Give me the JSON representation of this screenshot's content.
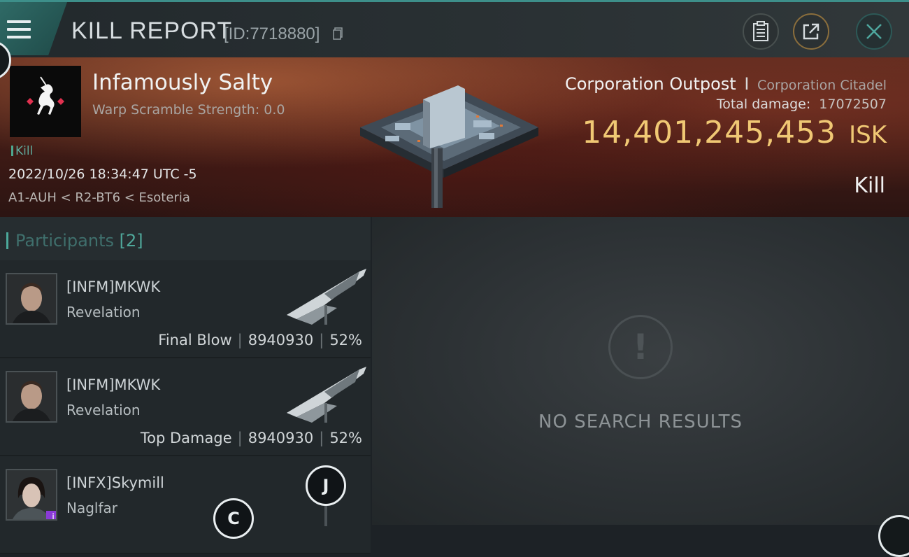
{
  "header": {
    "title": "KILL REPORT",
    "report_id": "[ID:7718880]"
  },
  "victim": {
    "name": "Infamously Salty",
    "warp_scramble": "Warp Scramble Strength: 0.0",
    "kill_tag": "Kill",
    "datetime": "2022/10/26 18:34:47 UTC -5",
    "location": "A1-AUH < R2-BT6 < Esoteria"
  },
  "target": {
    "ship_name": "Corporation Outpost",
    "separator": "I",
    "ship_class": "Corporation Citadel",
    "total_damage_label": "Total damage:",
    "total_damage_value": "17072507",
    "isk_value": "14,401,245,453",
    "isk_unit": "ISK",
    "result": "Kill"
  },
  "participants": {
    "label": "Participants",
    "count": "[2]",
    "rows": [
      {
        "name": "[INFM]MKWK",
        "ship": "Revelation",
        "role": "Final Blow",
        "damage": "8940930",
        "percent": "52%"
      },
      {
        "name": "[INFM]MKWK",
        "ship": "Revelation",
        "role": "Top Damage",
        "damage": "8940930",
        "percent": "52%"
      },
      {
        "name": "[INFX]Skymill",
        "ship": "Naglfar"
      }
    ]
  },
  "results": {
    "empty_message": "NO SEARCH RESULTS"
  },
  "overlay": {
    "marker_j": "J",
    "marker_c": "C"
  },
  "icons": {
    "menu": "hamburger-icon",
    "copy": "copy-icon",
    "clipboard": "clipboard-icon",
    "share": "share-icon",
    "close": "close-icon",
    "warning": "exclamation-icon"
  },
  "colors": {
    "accent": "#4ca99b",
    "isk": "#f0c874",
    "banner": "#4a1f18"
  }
}
